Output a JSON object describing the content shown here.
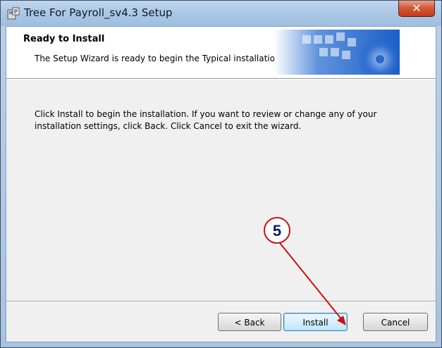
{
  "window": {
    "title": "Tree For Payroll_sv4.3 Setup",
    "close_label": "✕"
  },
  "banner": {
    "title": "Ready to Install",
    "description": "The Setup Wizard is ready to begin the Typical installation"
  },
  "body": {
    "message": "Click Install to begin the installation.  If you want to review or change any of your installation settings, click Back.  Click Cancel to exit the wizard."
  },
  "buttons": {
    "back": "< Back",
    "install": "Install",
    "cancel": "Cancel"
  },
  "annotation": {
    "step_number": "5",
    "color": "#cc1111"
  },
  "colors": {
    "banner_accent": "#1a5fc8",
    "title_bar": "#a9c6e4",
    "close_button": "#c23a1b"
  }
}
